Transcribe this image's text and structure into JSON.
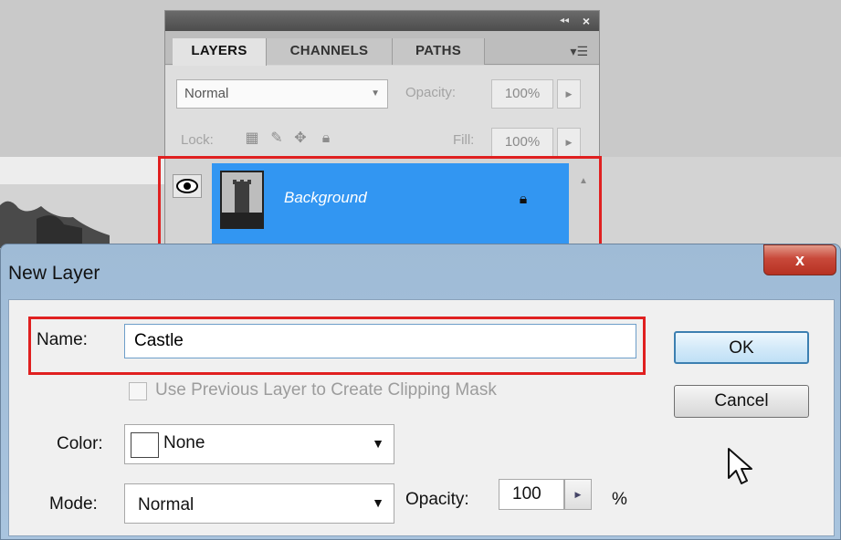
{
  "layers_panel": {
    "collapse_icon": "double-chevron-left-icon",
    "close_icon": "close-icon",
    "tabs": [
      {
        "label": "LAYERS",
        "active": true
      },
      {
        "label": "CHANNELS",
        "active": false
      },
      {
        "label": "PATHS",
        "active": false
      }
    ],
    "blend_mode": "Normal",
    "opacity_label": "Opacity:",
    "opacity_value": "100%",
    "lock_label": "Lock:",
    "fill_label": "Fill:",
    "fill_value": "100%",
    "layer": {
      "name": "Background",
      "visible": true,
      "locked": true,
      "selected_color": "#3296f2"
    }
  },
  "new_layer_dialog": {
    "title": "New Layer",
    "name_label": "Name:",
    "name_value": "Castle",
    "clipping_mask_label": "Use Previous Layer to Create Clipping Mask",
    "clipping_mask_checked": false,
    "color_label": "Color:",
    "color_value": "None",
    "mode_label": "Mode:",
    "mode_value": "Normal",
    "opacity_label": "Opacity:",
    "opacity_value": "100",
    "opacity_unit": "%",
    "ok_label": "OK",
    "cancel_label": "Cancel",
    "close_label": "x"
  },
  "highlight_color": "#e02020"
}
